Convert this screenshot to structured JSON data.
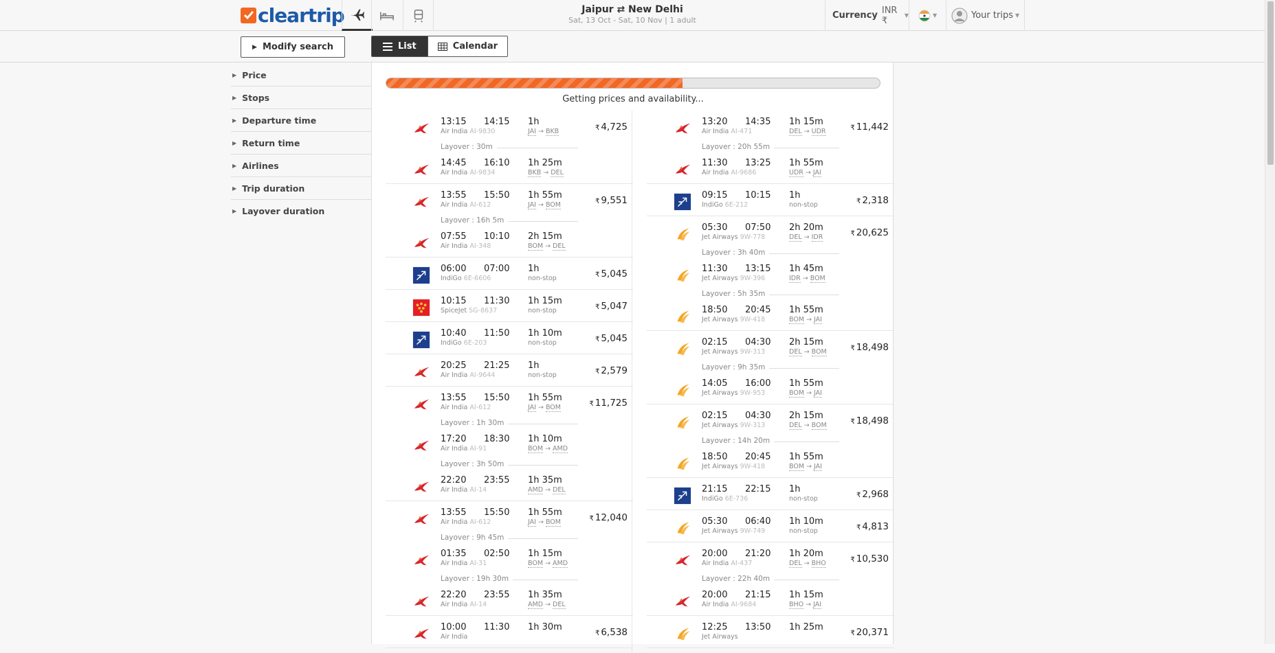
{
  "header": {
    "logo_text": "cleartrip",
    "trip_title": "Jaipur ⇄ New Delhi",
    "trip_sub": "Sat, 13 Oct - Sat, 10 Nov | 1 adult",
    "currency_label": "Currency",
    "currency_value": "INR ₹",
    "your_trips": "Your trips"
  },
  "subbar": {
    "modify": "Modify search",
    "list": "List",
    "calendar": "Calendar"
  },
  "filters": [
    "Price",
    "Stops",
    "Departure time",
    "Return time",
    "Airlines",
    "Trip duration",
    "Layover duration"
  ],
  "progress": {
    "text": "Getting prices and availability...",
    "fraction": 0.6
  },
  "colors": {
    "accent": "#f26722",
    "brand": "#1e5aa8",
    "airindia": "#d7262e",
    "indigo": "#1d3f8c",
    "jet": "#f6a623",
    "spicejet": "#e41f26"
  },
  "onward": [
    {
      "price": "4,725",
      "legs": [
        {
          "dep": "13:15",
          "arr": "14:15",
          "airline": "Air India",
          "code": "AI-9830",
          "dur": "1h",
          "from": "JAI",
          "to": "BKB",
          "icon": "airindia"
        },
        {
          "layover": "Layover : 30m"
        },
        {
          "dep": "14:45",
          "arr": "16:10",
          "airline": "Air India",
          "code": "AI-9834",
          "dur": "1h 25m",
          "from": "BKB",
          "to": "DEL",
          "icon": "airindia"
        }
      ]
    },
    {
      "price": "9,551",
      "legs": [
        {
          "dep": "13:55",
          "arr": "15:50",
          "airline": "Air India",
          "code": "AI-612",
          "dur": "1h 55m",
          "from": "JAI",
          "to": "BOM",
          "icon": "airindia"
        },
        {
          "layover": "Layover : 16h 5m"
        },
        {
          "dep": "07:55",
          "arr": "10:10",
          "airline": "Air India",
          "code": "AI-348",
          "dur": "2h 15m",
          "from": "BOM",
          "to": "DEL",
          "icon": "airindia"
        }
      ]
    },
    {
      "price": "5,045",
      "legs": [
        {
          "dep": "06:00",
          "arr": "07:00",
          "airline": "IndiGo",
          "code": "6E-6606",
          "dur": "1h",
          "stop": "non-stop",
          "icon": "indigo"
        }
      ]
    },
    {
      "price": "5,047",
      "legs": [
        {
          "dep": "10:15",
          "arr": "11:30",
          "airline": "SpiceJet",
          "code": "SG-8637",
          "dur": "1h 15m",
          "stop": "non-stop",
          "icon": "spicejet"
        }
      ]
    },
    {
      "price": "5,045",
      "legs": [
        {
          "dep": "10:40",
          "arr": "11:50",
          "airline": "IndiGo",
          "code": "6E-203",
          "dur": "1h 10m",
          "stop": "non-stop",
          "icon": "indigo"
        }
      ]
    },
    {
      "price": "2,579",
      "legs": [
        {
          "dep": "20:25",
          "arr": "21:25",
          "airline": "Air India",
          "code": "AI-9644",
          "dur": "1h",
          "stop": "non-stop",
          "icon": "airindia"
        }
      ]
    },
    {
      "price": "11,725",
      "legs": [
        {
          "dep": "13:55",
          "arr": "15:50",
          "airline": "Air India",
          "code": "AI-612",
          "dur": "1h 55m",
          "from": "JAI",
          "to": "BOM",
          "icon": "airindia"
        },
        {
          "layover": "Layover : 1h 30m"
        },
        {
          "dep": "17:20",
          "arr": "18:30",
          "airline": "Air India",
          "code": "AI-91",
          "dur": "1h 10m",
          "from": "BOM",
          "to": "AMD",
          "icon": "airindia"
        },
        {
          "layover": "Layover : 3h 50m"
        },
        {
          "dep": "22:20",
          "arr": "23:55",
          "airline": "Air India",
          "code": "AI-14",
          "dur": "1h 35m",
          "from": "AMD",
          "to": "DEL",
          "icon": "airindia"
        }
      ]
    },
    {
      "price": "12,040",
      "legs": [
        {
          "dep": "13:55",
          "arr": "15:50",
          "airline": "Air India",
          "code": "AI-612",
          "dur": "1h 55m",
          "from": "JAI",
          "to": "BOM",
          "icon": "airindia"
        },
        {
          "layover": "Layover : 9h 45m"
        },
        {
          "dep": "01:35",
          "arr": "02:50",
          "airline": "Air India",
          "code": "AI-31",
          "dur": "1h 15m",
          "from": "BOM",
          "to": "AMD",
          "icon": "airindia"
        },
        {
          "layover": "Layover : 19h 30m"
        },
        {
          "dep": "22:20",
          "arr": "23:55",
          "airline": "Air India",
          "code": "AI-14",
          "dur": "1h 35m",
          "from": "AMD",
          "to": "DEL",
          "icon": "airindia"
        }
      ]
    },
    {
      "price": "6,538",
      "legs": [
        {
          "dep": "10:00",
          "arr": "11:30",
          "airline": "Air India",
          "code": "",
          "dur": "1h 30m",
          "stop": "",
          "icon": "airindia"
        }
      ]
    }
  ],
  "return": [
    {
      "price": "11,442",
      "legs": [
        {
          "dep": "13:20",
          "arr": "14:35",
          "airline": "Air India",
          "code": "AI-471",
          "dur": "1h 15m",
          "from": "DEL",
          "to": "UDR",
          "icon": "airindia"
        },
        {
          "layover": "Layover : 20h 55m"
        },
        {
          "dep": "11:30",
          "arr": "13:25",
          "airline": "Air India",
          "code": "AI-9686",
          "dur": "1h 55m",
          "from": "UDR",
          "to": "JAI",
          "icon": "airindia"
        }
      ]
    },
    {
      "price": "2,318",
      "legs": [
        {
          "dep": "09:15",
          "arr": "10:15",
          "airline": "IndiGo",
          "code": "6E-212",
          "dur": "1h",
          "stop": "non-stop",
          "icon": "indigo"
        }
      ]
    },
    {
      "price": "20,625",
      "legs": [
        {
          "dep": "05:30",
          "arr": "07:50",
          "airline": "Jet Airways",
          "code": "9W-778",
          "dur": "2h 20m",
          "from": "DEL",
          "to": "IDR",
          "icon": "jet"
        },
        {
          "layover": "Layover : 3h 40m"
        },
        {
          "dep": "11:30",
          "arr": "13:15",
          "airline": "Jet Airways",
          "code": "9W-396",
          "dur": "1h 45m",
          "from": "IDR",
          "to": "BOM",
          "icon": "jet"
        },
        {
          "layover": "Layover : 5h 35m"
        },
        {
          "dep": "18:50",
          "arr": "20:45",
          "airline": "Jet Airways",
          "code": "9W-418",
          "dur": "1h 55m",
          "from": "BOM",
          "to": "JAI",
          "icon": "jet"
        }
      ]
    },
    {
      "price": "18,498",
      "legs": [
        {
          "dep": "02:15",
          "arr": "04:30",
          "airline": "Jet Airways",
          "code": "9W-313",
          "dur": "2h 15m",
          "from": "DEL",
          "to": "BOM",
          "icon": "jet"
        },
        {
          "layover": "Layover : 9h 35m"
        },
        {
          "dep": "14:05",
          "arr": "16:00",
          "airline": "Jet Airways",
          "code": "9W-953",
          "dur": "1h 55m",
          "from": "BOM",
          "to": "JAI",
          "icon": "jet"
        }
      ]
    },
    {
      "price": "18,498",
      "legs": [
        {
          "dep": "02:15",
          "arr": "04:30",
          "airline": "Jet Airways",
          "code": "9W-313",
          "dur": "2h 15m",
          "from": "DEL",
          "to": "BOM",
          "icon": "jet"
        },
        {
          "layover": "Layover : 14h 20m"
        },
        {
          "dep": "18:50",
          "arr": "20:45",
          "airline": "Jet Airways",
          "code": "9W-418",
          "dur": "1h 55m",
          "from": "BOM",
          "to": "JAI",
          "icon": "jet"
        }
      ]
    },
    {
      "price": "2,968",
      "legs": [
        {
          "dep": "21:15",
          "arr": "22:15",
          "airline": "IndiGo",
          "code": "6E-736",
          "dur": "1h",
          "stop": "non-stop",
          "icon": "indigo"
        }
      ]
    },
    {
      "price": "4,813",
      "legs": [
        {
          "dep": "05:30",
          "arr": "06:40",
          "airline": "Jet Airways",
          "code": "9W-749",
          "dur": "1h 10m",
          "stop": "non-stop",
          "icon": "jet"
        }
      ]
    },
    {
      "price": "10,530",
      "legs": [
        {
          "dep": "20:00",
          "arr": "21:20",
          "airline": "Air India",
          "code": "AI-437",
          "dur": "1h 20m",
          "from": "DEL",
          "to": "BHO",
          "icon": "airindia"
        },
        {
          "layover": "Layover : 22h 40m"
        },
        {
          "dep": "20:00",
          "arr": "21:15",
          "airline": "Air India",
          "code": "AI-9684",
          "dur": "1h 15m",
          "from": "BHO",
          "to": "JAI",
          "icon": "airindia"
        }
      ]
    },
    {
      "price": "20,371",
      "legs": [
        {
          "dep": "12:25",
          "arr": "13:50",
          "airline": "Jet Airways",
          "code": "",
          "dur": "1h 25m",
          "stop": "",
          "icon": "jet"
        }
      ]
    }
  ]
}
